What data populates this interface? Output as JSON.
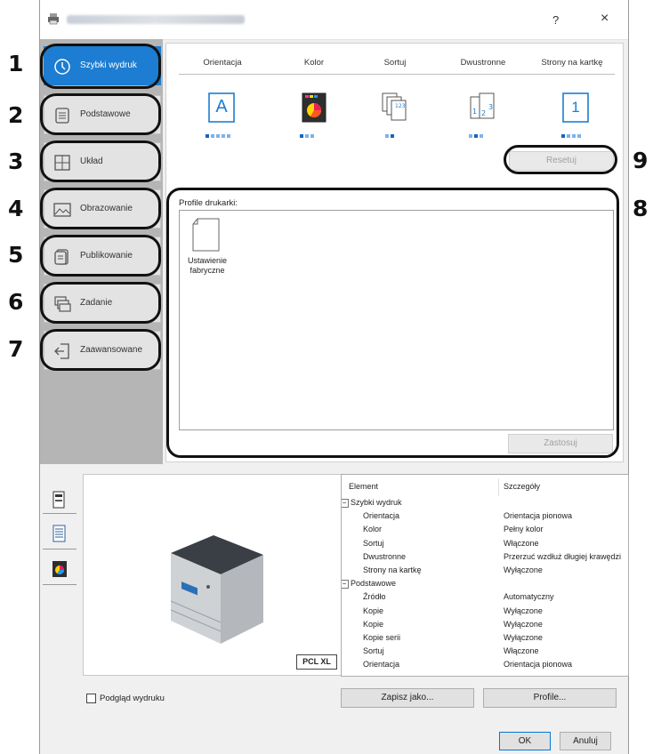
{
  "callouts": {
    "n1": "1",
    "n2": "2",
    "n3": "3",
    "n4": "4",
    "n5": "5",
    "n6": "6",
    "n7": "7",
    "n8": "8",
    "n9": "9"
  },
  "titlebar": {
    "help": "?",
    "close": "×"
  },
  "nav": {
    "items": [
      {
        "label": "Szybki wydruk",
        "icon": "clock-icon"
      },
      {
        "label": "Podstawowe",
        "icon": "document-icon"
      },
      {
        "label": "Układ",
        "icon": "layout-grid-icon"
      },
      {
        "label": "Obrazowanie",
        "icon": "image-icon"
      },
      {
        "label": "Publikowanie",
        "icon": "booklet-icon"
      },
      {
        "label": "Zadanie",
        "icon": "job-stack-icon"
      },
      {
        "label": "Zaawansowane",
        "icon": "advanced-icon"
      }
    ]
  },
  "quickprint": {
    "options": [
      {
        "label": "Orientacja",
        "icon": "orientation-icon",
        "glyph": "A"
      },
      {
        "label": "Kolor",
        "icon": "color-icon"
      },
      {
        "label": "Sortuj",
        "icon": "collate-icon"
      },
      {
        "label": "Dwustronne",
        "icon": "duplex-icon"
      },
      {
        "label": "Strony na kartkę",
        "icon": "pages-per-sheet-icon",
        "glyph": "1"
      }
    ],
    "reset": "Resetuj"
  },
  "profiles": {
    "label": "Profile drukarki:",
    "items": [
      {
        "name": "Ustawienie fabryczne"
      }
    ],
    "apply": "Zastosuj"
  },
  "preview": {
    "badge": "PCL XL"
  },
  "details": {
    "header_element": "Element",
    "header_details": "Szczegóły",
    "rows": [
      {
        "group": true,
        "element": "Szybki wydruk",
        "value": ""
      },
      {
        "element": "Orientacja",
        "value": "Orientacja pionowa"
      },
      {
        "element": "Kolor",
        "value": "Pełny kolor"
      },
      {
        "element": "Sortuj",
        "value": "Włączone"
      },
      {
        "element": "Dwustronne",
        "value": "Przerzuć wzdłuż długiej krawędzi"
      },
      {
        "element": "Strony na kartkę",
        "value": "Wyłączone"
      },
      {
        "group": true,
        "element": "Podstawowe",
        "value": ""
      },
      {
        "element": "Źródło",
        "value": "Automatyczny"
      },
      {
        "element": "Kopie",
        "value": "Wyłączone"
      },
      {
        "element": "Kopie",
        "value": "Wyłączone"
      },
      {
        "element": "Kopie serii",
        "value": "Wyłączone"
      },
      {
        "element": "Sortuj",
        "value": "Włączone"
      },
      {
        "element": "Orientacja",
        "value": "Orientacja pionowa"
      }
    ]
  },
  "footer": {
    "preview_checkbox": "Podgląd wydruku",
    "save_as": "Zapisz jako...",
    "profile": "Profile...",
    "ok": "OK",
    "cancel": "Anuluj"
  }
}
